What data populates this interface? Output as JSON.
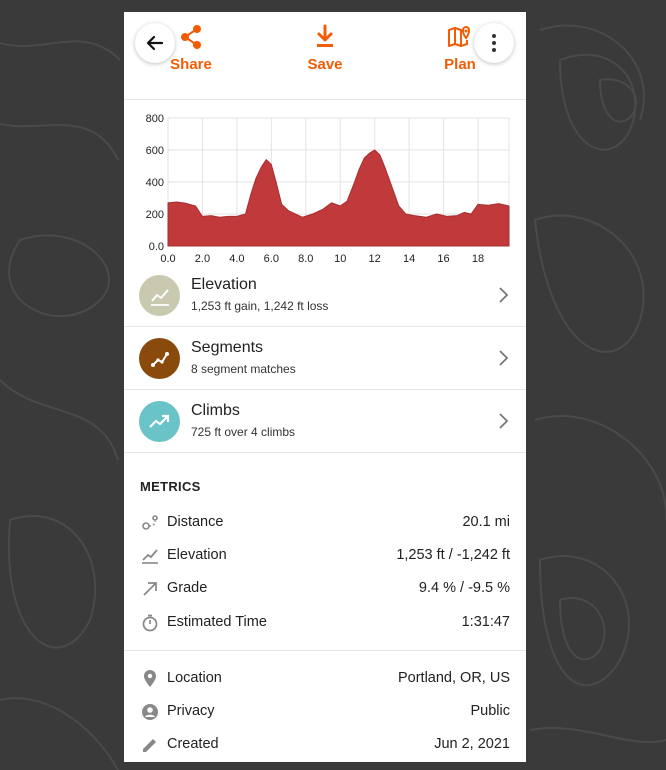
{
  "header": {
    "back_icon": "arrow-left-icon",
    "more_icon": "more-vertical-icon",
    "actions": [
      {
        "label": "Share",
        "icon": "share-icon"
      },
      {
        "label": "Save",
        "icon": "download-icon"
      },
      {
        "label": "Plan",
        "icon": "map-pin-icon"
      }
    ],
    "accent_color": "#f25c05"
  },
  "chart_data": {
    "type": "area",
    "x_ticks": [
      "0.0",
      "2.0",
      "4.0",
      "6.0",
      "8.0",
      "10",
      "12",
      "14",
      "16",
      "18"
    ],
    "y_ticks": [
      "0.0",
      "200",
      "400",
      "600",
      "800"
    ],
    "xlim": [
      0,
      19.8
    ],
    "ylim": [
      0,
      800
    ],
    "fill_color": "#c0393b",
    "grid": true,
    "x": [
      0,
      0.5,
      1.0,
      1.6,
      2.0,
      2.5,
      3.0,
      3.5,
      4.0,
      4.5,
      4.8,
      5.1,
      5.4,
      5.7,
      6.0,
      6.3,
      6.6,
      7.0,
      7.4,
      7.8,
      8.4,
      9.0,
      9.5,
      10.0,
      10.4,
      10.8,
      11.1,
      11.4,
      11.7,
      12.0,
      12.3,
      12.6,
      13.0,
      13.4,
      13.8,
      14.3,
      15.0,
      15.6,
      16.2,
      16.8,
      17.2,
      17.6,
      18.0,
      18.6,
      19.2,
      19.8
    ],
    "y": [
      270,
      275,
      268,
      250,
      185,
      190,
      180,
      185,
      185,
      200,
      320,
      420,
      490,
      540,
      510,
      390,
      260,
      220,
      200,
      180,
      200,
      230,
      270,
      250,
      280,
      390,
      480,
      550,
      580,
      600,
      570,
      490,
      370,
      250,
      200,
      190,
      180,
      200,
      185,
      190,
      210,
      200,
      260,
      255,
      265,
      250
    ]
  },
  "analyses": [
    {
      "title": "Elevation",
      "subtitle": "1,253 ft gain, 1,242 ft loss",
      "icon": "trend-line-icon",
      "color": "#c9c9b0"
    },
    {
      "title": "Segments",
      "subtitle": "8 segment matches",
      "icon": "segments-icon",
      "color": "#8a4a0c"
    },
    {
      "title": "Climbs",
      "subtitle": "725 ft over 4 climbs",
      "icon": "trend-up-icon",
      "color": "#69c3c7"
    }
  ],
  "metrics_title": "METRICS",
  "metrics": [
    {
      "label": "Distance",
      "value": "20.1 mi",
      "icon": "route-icon"
    },
    {
      "label": "Elevation",
      "value": "1,253 ft / -1,242 ft",
      "icon": "elevation-icon"
    },
    {
      "label": "Grade",
      "value": "9.4 % / -9.5 %",
      "icon": "grade-arrow-icon"
    },
    {
      "label": "Estimated Time",
      "value": "1:31:47",
      "icon": "stopwatch-icon"
    }
  ],
  "details": [
    {
      "label": "Location",
      "value": "Portland, OR, US",
      "icon": "location-pin-icon"
    },
    {
      "label": "Privacy",
      "value": "Public",
      "icon": "person-icon"
    },
    {
      "label": "Created",
      "value": "Jun 2, 2021",
      "icon": "pencil-icon"
    }
  ]
}
